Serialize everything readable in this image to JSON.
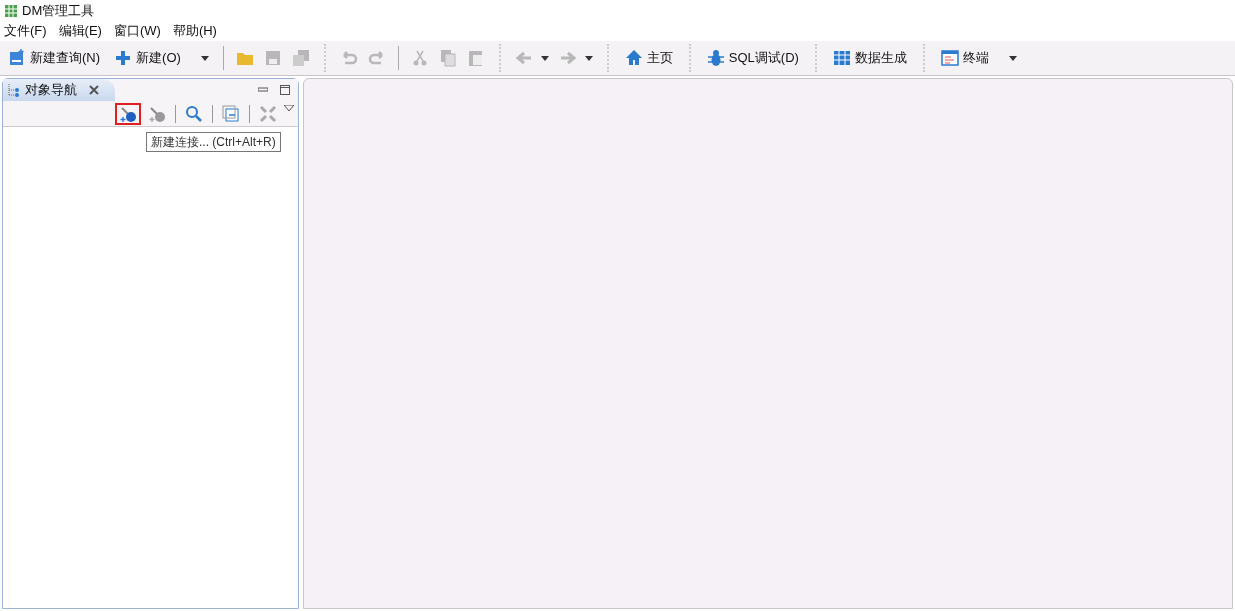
{
  "window": {
    "title": "DM管理工具"
  },
  "menu": [
    "文件(F)",
    "编辑(E)",
    "窗口(W)",
    "帮助(H)"
  ],
  "toolbar": [
    {
      "kind": "button",
      "label": "新建查询(N)",
      "disabled": false,
      "dropdown": false
    },
    {
      "kind": "button",
      "label": "新建(O)",
      "disabled": false,
      "dropdown": true
    },
    {
      "kind": "sep"
    },
    {
      "kind": "icon",
      "disabled": false,
      "dropdown": false
    },
    {
      "kind": "icon",
      "disabled": true,
      "dropdown": false
    },
    {
      "kind": "icon",
      "disabled": true,
      "dropdown": false
    },
    {
      "kind": "grip"
    },
    {
      "kind": "icon",
      "disabled": true,
      "dropdown": false
    },
    {
      "kind": "icon",
      "disabled": true,
      "dropdown": false
    },
    {
      "kind": "sep"
    },
    {
      "kind": "icon",
      "disabled": true,
      "dropdown": false
    },
    {
      "kind": "icon",
      "disabled": true,
      "dropdown": false
    },
    {
      "kind": "icon",
      "disabled": true,
      "dropdown": false
    },
    {
      "kind": "grip"
    },
    {
      "kind": "icon",
      "disabled": true,
      "dropdown": true
    },
    {
      "kind": "icon",
      "disabled": true,
      "dropdown": true
    },
    {
      "kind": "grip"
    },
    {
      "kind": "button",
      "label": "主页",
      "disabled": false,
      "dropdown": false
    },
    {
      "kind": "grip"
    },
    {
      "kind": "button",
      "label": "SQL调试(D)",
      "disabled": false,
      "dropdown": false
    },
    {
      "kind": "grip"
    },
    {
      "kind": "button",
      "label": "数据生成",
      "disabled": false,
      "dropdown": false
    },
    {
      "kind": "grip"
    },
    {
      "kind": "button",
      "label": "终端",
      "disabled": false,
      "dropdown": true
    }
  ],
  "navigator": {
    "tab": "对象导航",
    "tools": [
      {
        "kind": "icon",
        "disabled": false,
        "highlighted": true
      },
      {
        "kind": "icon",
        "disabled": true,
        "highlighted": false
      },
      {
        "kind": "sep"
      },
      {
        "kind": "icon",
        "disabled": false,
        "highlighted": false
      },
      {
        "kind": "sep"
      },
      {
        "kind": "icon",
        "disabled": false,
        "highlighted": false
      },
      {
        "kind": "sep"
      },
      {
        "kind": "icon",
        "disabled": true,
        "highlighted": false
      }
    ],
    "tooltip": "新建连接... (Ctrl+Alt+R)"
  }
}
